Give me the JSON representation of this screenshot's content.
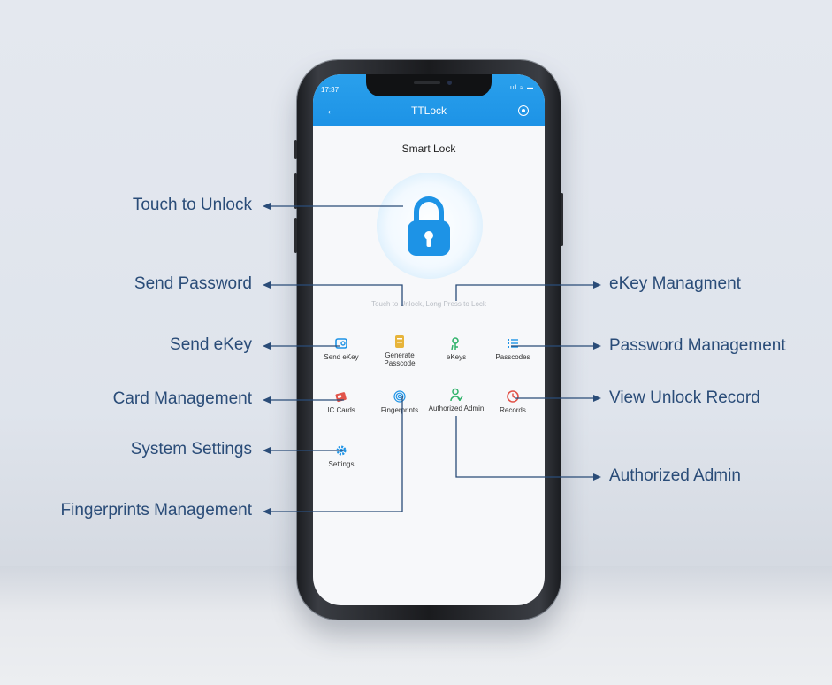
{
  "status_bar": {
    "time": "17:37",
    "icons": "ııl ≈ ▬"
  },
  "app": {
    "title": "TTLock",
    "lock_name": "Smart Lock",
    "hint": "Touch to Unlock, Long Press to Lock"
  },
  "features": [
    {
      "label": "Send eKey",
      "icon": "send-ekey-icon",
      "color": "#1d93e6"
    },
    {
      "label": "Generate Passcode",
      "icon": "passcode-icon",
      "color": "#e7b43a"
    },
    {
      "label": "eKeys",
      "icon": "ekeys-icon",
      "color": "#31b36b"
    },
    {
      "label": "Passcodes",
      "icon": "passcodes-list-icon",
      "color": "#1d93e6"
    },
    {
      "label": "IC Cards",
      "icon": "ic-card-icon",
      "color": "#e2544a"
    },
    {
      "label": "Fingerprints",
      "icon": "fingerprint-icon",
      "color": "#1d93e6"
    },
    {
      "label": "Authorized Admin",
      "icon": "admin-icon",
      "color": "#31b36b"
    },
    {
      "label": "Records",
      "icon": "records-icon",
      "color": "#e2544a"
    },
    {
      "label": "Settings",
      "icon": "settings-gear-icon",
      "color": "#1d93e6"
    }
  ],
  "callouts": {
    "touch_unlock": "Touch to Unlock",
    "send_password": "Send Password",
    "send_ekey": "Send eKey",
    "card_management": "Card Management",
    "system_settings": "System Settings",
    "fingerprints_management": "Fingerprints Management",
    "ekey_management": "eKey Managment",
    "password_management": "Password Management",
    "view_unlock_record": "View Unlock Record",
    "authorized_admin": "Authorized Admin"
  },
  "colors": {
    "accent": "#1d93e6",
    "callout_text": "#2a4c78",
    "line": "#2a4c78"
  }
}
